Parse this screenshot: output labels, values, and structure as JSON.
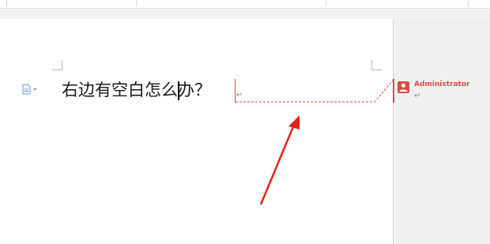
{
  "document": {
    "paragraph_text": "右边有空白怎么办？",
    "paragraph_mark": "↵"
  },
  "comment": {
    "author": "Administrator",
    "paragraph_mark": "↵"
  },
  "colors": {
    "comment_accent": "#d94a4a",
    "annotation_arrow": "#e8201a"
  }
}
